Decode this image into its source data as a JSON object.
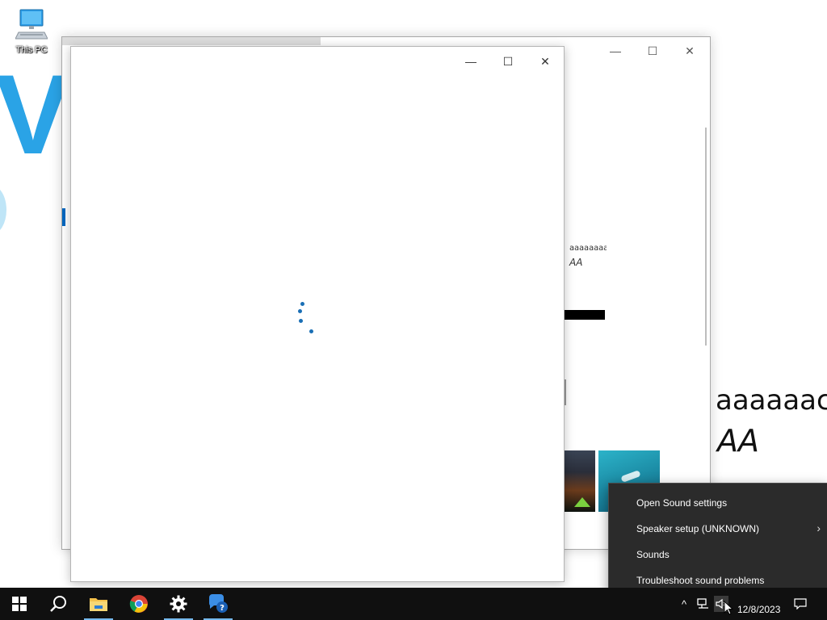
{
  "desktop": {
    "icons": [
      {
        "label": "This PC",
        "icon": "computer-icon"
      }
    ],
    "wallpaper": {
      "letter_v": "V",
      "text_lower": "aaaaaac",
      "text_upper": "AA"
    }
  },
  "background_window": {
    "preview_lower": "aaaaaaaaaa",
    "preview_upper": "AA",
    "controls": {
      "minimize": "—",
      "maximize": "☐",
      "close": "✕"
    }
  },
  "foreground_window": {
    "state": "loading",
    "controls": {
      "minimize": "—",
      "maximize": "☐",
      "close": "✕"
    }
  },
  "context_menu": {
    "items": [
      {
        "label": "Open Sound settings",
        "submenu": false
      },
      {
        "label": "Speaker setup (UNKNOWN)",
        "submenu": true
      },
      {
        "label": "Sounds",
        "submenu": false
      },
      {
        "label": "Troubleshoot sound problems",
        "submenu": false
      }
    ],
    "submenu_arrow": "›"
  },
  "taskbar": {
    "buttons": [
      {
        "name": "start",
        "icon": "windows-icon"
      },
      {
        "name": "search",
        "icon": "search-icon"
      },
      {
        "name": "file-explorer",
        "icon": "folder-icon",
        "active": true
      },
      {
        "name": "chrome",
        "icon": "chrome-icon"
      },
      {
        "name": "settings",
        "icon": "gear-icon",
        "active": true
      },
      {
        "name": "get-help",
        "icon": "help-icon",
        "active": true
      }
    ],
    "tray": {
      "chevron": "^",
      "date": "12/8/2023"
    }
  },
  "colors": {
    "taskbar_bg": "#101010",
    "menu_bg": "#2b2b2b",
    "accent": "#0067c0",
    "spinner": "#1a6fb5"
  }
}
